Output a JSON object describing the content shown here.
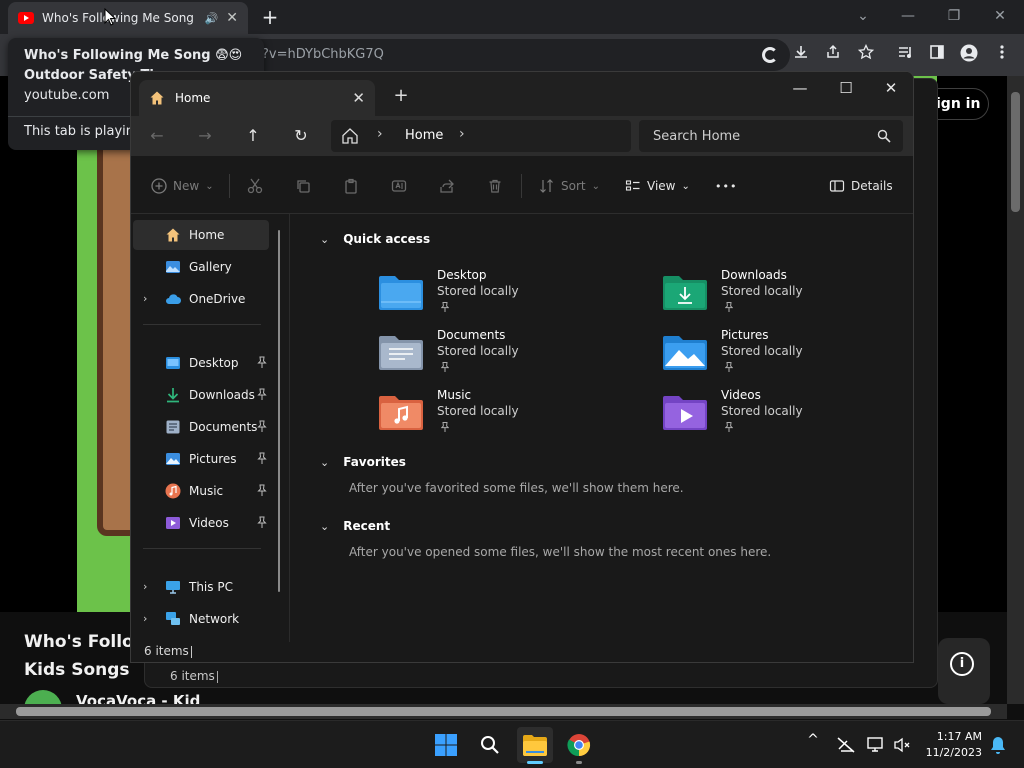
{
  "chrome": {
    "tab_title": "Who's Following Me Song 😨😍",
    "tab_close": "✕",
    "new_tab": "+",
    "minimize": "⌄",
    "minimize2": "—",
    "restore": "❐",
    "close": "✕",
    "url_visible": "?v=hDYbChbKG7Q",
    "hover_card": {
      "title_line1": "Who's Following Me Song 😨😍",
      "title_line2": "Outdoor Safety Ti",
      "domain": "youtube.com",
      "note": "This tab is playing"
    }
  },
  "youtube": {
    "sign_in": "ign in",
    "video_title_line1": "Who's Follow",
    "video_title_line2": "Kids Songs & N",
    "channel": "VocaVoca - Kid",
    "info_glyph": "i"
  },
  "explorer_shadow": {
    "status_count": "6 items"
  },
  "explorer": {
    "tab_title": "Home",
    "tab_close": "✕",
    "new_tab": "+",
    "window_controls": {
      "minimize": "—",
      "maximize": "☐",
      "close": "✕"
    },
    "nav": {
      "back": "←",
      "forward": "→",
      "up": "↑",
      "refresh": "↻"
    },
    "address": {
      "crumb": "Home",
      "chevron": "›"
    },
    "search": {
      "placeholder": "Search Home"
    },
    "commands": {
      "new": "New",
      "sort": "Sort",
      "view": "View",
      "more": "•••",
      "details": "Details",
      "dropdown": "⌄"
    },
    "sidebar": {
      "items": [
        {
          "label": "Home"
        },
        {
          "label": "Gallery"
        },
        {
          "label": "OneDrive"
        },
        {
          "label": "Desktop"
        },
        {
          "label": "Downloads"
        },
        {
          "label": "Documents"
        },
        {
          "label": "Pictures"
        },
        {
          "label": "Music"
        },
        {
          "label": "Videos"
        },
        {
          "label": "This PC"
        },
        {
          "label": "Network"
        }
      ],
      "expand_glyph": "›"
    },
    "main": {
      "quick_access": {
        "heading": "Quick access",
        "folders": [
          {
            "name": "Desktop",
            "sub": "Stored locally"
          },
          {
            "name": "Downloads",
            "sub": "Stored locally"
          },
          {
            "name": "Documents",
            "sub": "Stored locally"
          },
          {
            "name": "Pictures",
            "sub": "Stored locally"
          },
          {
            "name": "Music",
            "sub": "Stored locally"
          },
          {
            "name": "Videos",
            "sub": "Stored locally"
          }
        ]
      },
      "favorites": {
        "heading": "Favorites",
        "empty": "After you've favorited some files, we'll show them here."
      },
      "recent": {
        "heading": "Recent",
        "empty": "After you've opened some files, we'll show the most recent ones here."
      },
      "chevron": "⌄"
    },
    "status": {
      "count": "6 items"
    }
  },
  "taskbar": {
    "time": "1:17 AM",
    "date": "11/2/2023",
    "tray_chevron": "^"
  },
  "colors": {
    "accent": "#60cdff",
    "youtube_red": "#ff0000",
    "folder_blue": "#2b8fe0",
    "folder_green": "#1ba776",
    "folder_orange": "#e8744f",
    "folder_purple": "#8d5bd9"
  }
}
